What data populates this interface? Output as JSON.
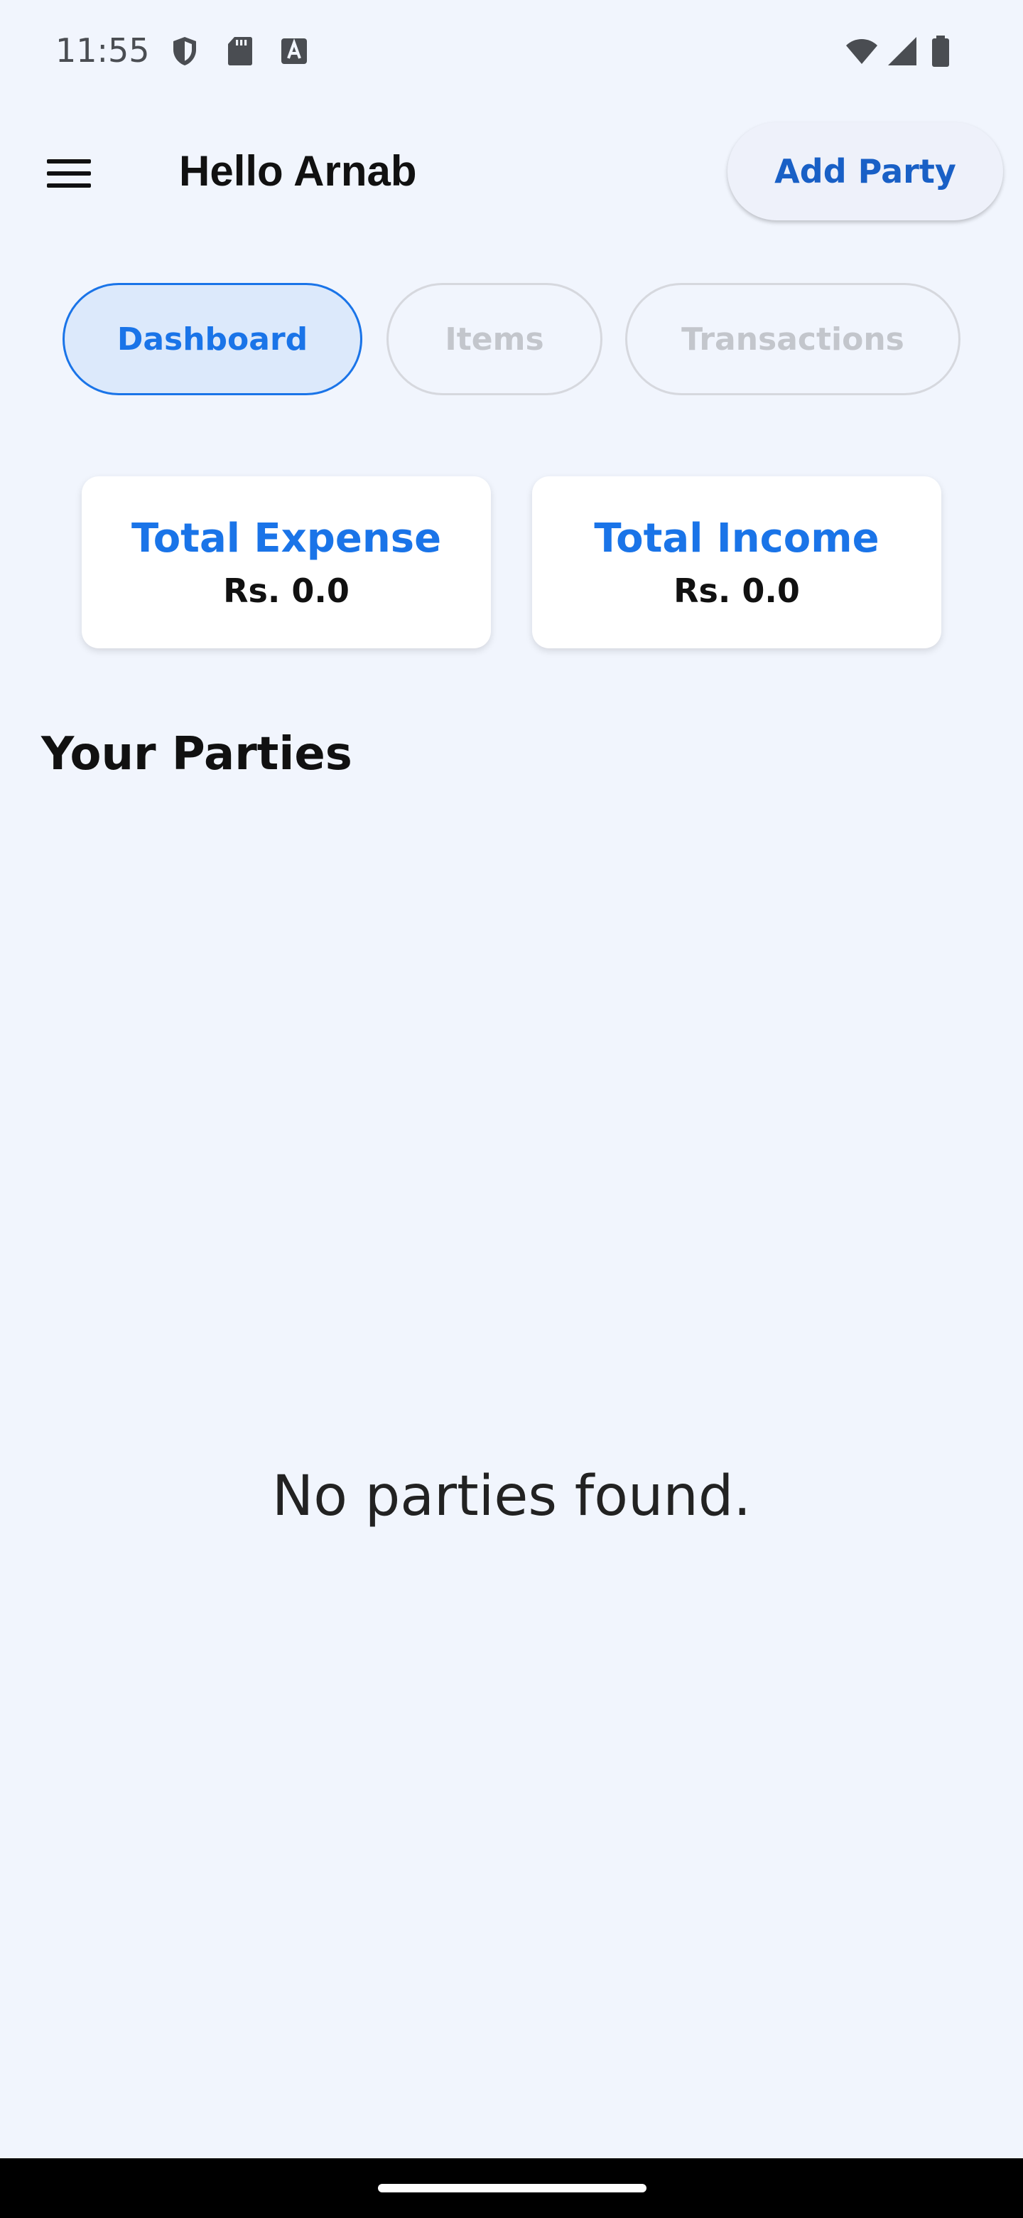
{
  "status_bar": {
    "time": "11:55",
    "left_icons": [
      "shield-icon",
      "sd-card-icon",
      "text-a-icon"
    ],
    "right_icons": [
      "wifi-icon",
      "cell-signal-icon",
      "battery-icon"
    ]
  },
  "app_bar": {
    "menu_icon": "hamburger-menu-icon",
    "greeting": "Hello Arnab",
    "add_party_label": "Add Party"
  },
  "tabs": [
    {
      "label": "Dashboard",
      "active": true
    },
    {
      "label": "Items",
      "active": false
    },
    {
      "label": "Transactions",
      "active": false
    }
  ],
  "summary": {
    "expense": {
      "title": "Total Expense",
      "value": "Rs. 0.0"
    },
    "income": {
      "title": "Total Income",
      "value": "Rs. 0.0"
    }
  },
  "parties": {
    "section_title": "Your Parties",
    "empty_message": "No parties found."
  },
  "colors": {
    "background": "#f1f5fd",
    "accent": "#1a74e8",
    "active_tab_bg": "#dce9fb",
    "button_text": "#1960c6"
  }
}
